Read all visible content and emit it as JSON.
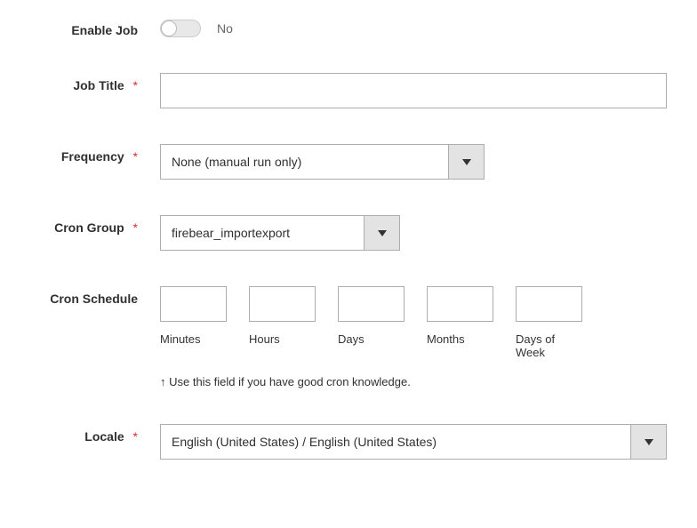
{
  "enable": {
    "label": "Enable Job",
    "value_text": "No",
    "on": false
  },
  "jobtitle": {
    "label": "Job Title",
    "value": ""
  },
  "frequency": {
    "label": "Frequency",
    "value": "None (manual run only)"
  },
  "crongroup": {
    "label": "Cron Group",
    "value": "firebear_importexport"
  },
  "cronschedule": {
    "label": "Cron Schedule",
    "parts": {
      "minutes": {
        "label": "Minutes",
        "value": ""
      },
      "hours": {
        "label": "Hours",
        "value": ""
      },
      "days": {
        "label": "Days",
        "value": ""
      },
      "months": {
        "label": "Months",
        "value": ""
      },
      "dow": {
        "label": "Days of Week",
        "value": ""
      }
    },
    "note": "↑ Use this field if you have good cron knowledge."
  },
  "locale": {
    "label": "Locale",
    "value": "English (United States) / English (United States)"
  },
  "required_mark": "*"
}
